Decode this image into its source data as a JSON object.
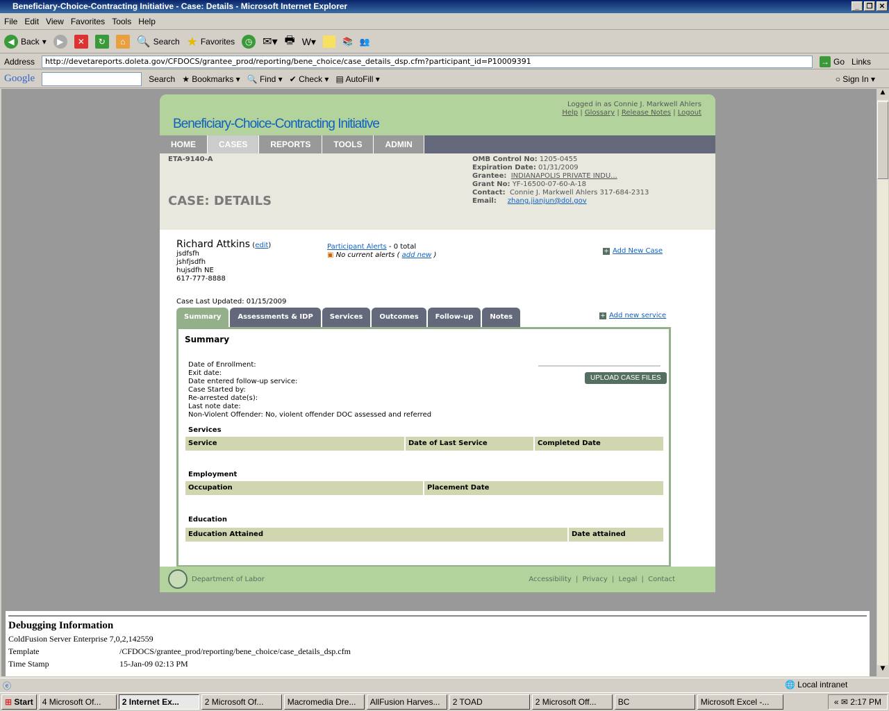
{
  "window": {
    "title": "Beneficiary-Choice-Contracting Initiative - Case: Details - Microsoft Internet Explorer"
  },
  "menu": [
    "File",
    "Edit",
    "View",
    "Favorites",
    "Tools",
    "Help"
  ],
  "toolbar": {
    "back": "Back",
    "search": "Search",
    "favorites": "Favorites"
  },
  "address": {
    "label": "Address",
    "url": "http://devetareports.doleta.gov/CFDOCS/grantee_prod/reporting/bene_choice/case_details_dsp.cfm?participant_id=P10009391",
    "go": "Go",
    "links": "Links"
  },
  "google": {
    "logo": "Google",
    "search": "Search",
    "bookmarks": "Bookmarks",
    "find": "Find",
    "check": "Check",
    "autofill": "AutoFill",
    "signin": "Sign In"
  },
  "app": {
    "title": "Beneficiary-Choice-Contracting Initiative",
    "logged_in": "Logged in as Connie J. Markwell Ahlers",
    "links": [
      "Help",
      "Glossary",
      "Release Notes",
      "Logout"
    ],
    "nav": [
      "HOME",
      "CASES",
      "REPORTS",
      "TOOLS",
      "ADMIN"
    ],
    "form_id": "ETA-9140-A",
    "page_title": "CASE: DETAILS",
    "meta": {
      "omb_label": "OMB Control No:",
      "omb": "1205-0455",
      "exp_label": "Expiration Date:",
      "exp": "01/31/2009",
      "grantee_label": "Grantee:",
      "grantee": "INDIANAPOLIS PRIVATE INDU...",
      "grant_label": "Grant No:",
      "grant": "YF-16500-07-60-A-18",
      "contact_label": "Contact:",
      "contact": "Connie J. Markwell Ahlers  317-684-2313",
      "email_label": "Email:",
      "email": "zhang.jianjun@dol.gov"
    }
  },
  "participant": {
    "name": "Richard Attkins",
    "edit": "edit",
    "lines": [
      "jsdfsfh",
      "jshfjsdfh",
      "hujsdfh NE",
      "617-777-8888"
    ]
  },
  "alerts": {
    "link": "Participant Alerts",
    "total": " - 0 total",
    "none": "No current alerts (",
    "add_new": "add new",
    "close": ")"
  },
  "add_new_case": "Add New Case",
  "add_new_service": "Add new service",
  "last_updated": "Case Last Updated: 01/15/2009",
  "tabs": [
    "Summary",
    "Assessments & IDP",
    "Services",
    "Outcomes",
    "Follow-up",
    "Notes"
  ],
  "summary": {
    "title": "Summary",
    "fields": [
      "Date of Enrollment:",
      "Exit date:",
      "Date entered follow-up service:",
      "Case Started by:",
      "Re-arrested date(s):",
      "Last note date:",
      "Non-Violent Offender: No, violent offender DOC assessed and referred"
    ],
    "upload": "UPLOAD CASE FILES",
    "services": {
      "title": "Services",
      "cols": [
        "Service",
        "Date of Last Service",
        "Completed Date"
      ]
    },
    "employment": {
      "title": "Employment",
      "cols": [
        "Occupation",
        "Placement Date"
      ]
    },
    "education": {
      "title": "Education",
      "cols": [
        "Education Attained",
        "Date attained"
      ]
    }
  },
  "footer": {
    "dept": "Department of Labor",
    "links": [
      "Accessibility",
      "Privacy",
      "Legal",
      "Contact"
    ]
  },
  "debug": {
    "title": "Debugging Information",
    "rows": [
      [
        "ColdFusion Server Enterprise",
        "7,0,2,142559"
      ],
      [
        "Template",
        "/CFDOCS/grantee_prod/reporting/bene_choice/case_details_dsp.cfm"
      ],
      [
        "Time Stamp",
        "15-Jan-09 02:13 PM"
      ]
    ]
  },
  "status": {
    "zone": "Local intranet"
  },
  "taskbar": {
    "start": "Start",
    "items": [
      "4 Microsoft Of...",
      "2 Internet Ex...",
      "2 Microsoft Of...",
      "Macromedia Dre...",
      "AllFusion Harves...",
      "2 TOAD",
      "2 Microsoft Off...",
      "BC",
      "Microsoft Excel -..."
    ],
    "clock": "2:17 PM"
  }
}
